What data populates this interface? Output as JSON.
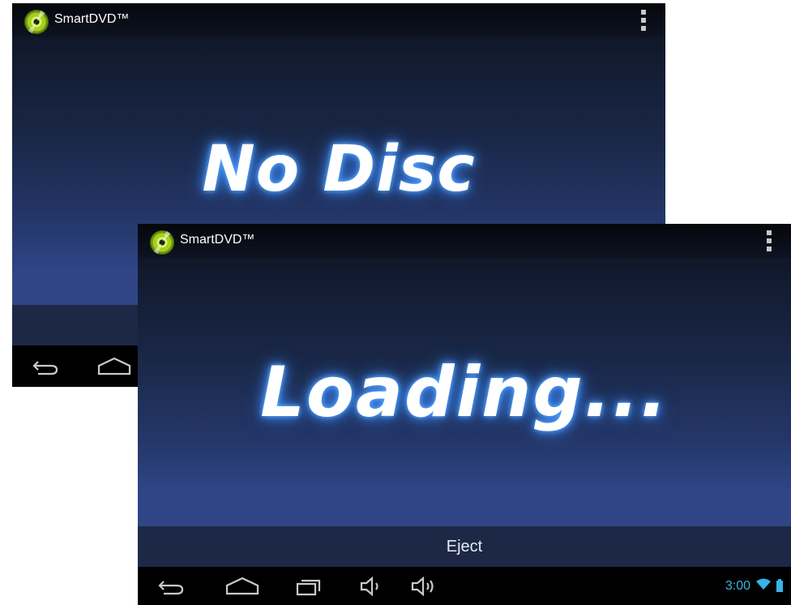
{
  "app": {
    "title": "SmartDVD™"
  },
  "back_screen": {
    "status": "No Disc"
  },
  "front_screen": {
    "status": "Loading...",
    "eject_label": "Eject"
  },
  "status_bar": {
    "time": "3:00"
  },
  "icons": {
    "app": "disc-icon",
    "overflow": "overflow-menu-icon",
    "back": "back-icon",
    "home": "home-icon",
    "recents": "recent-apps-icon",
    "volume_down": "volume-down-icon",
    "volume_up": "volume-up-icon",
    "wifi": "wifi-icon",
    "battery": "battery-icon"
  },
  "colors": {
    "accent": "#33b5e5",
    "glow": "#3d8eff",
    "eject_bar": "#1c2846"
  }
}
